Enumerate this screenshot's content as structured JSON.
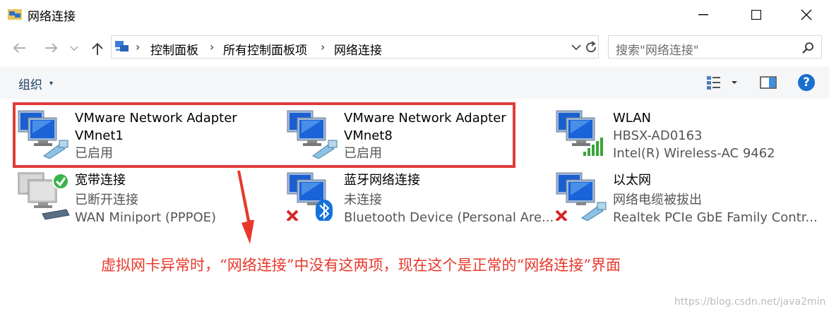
{
  "window": {
    "title": "网络连接"
  },
  "address": {
    "crumbs": [
      "控制面板",
      "所有控制面板项",
      "网络连接"
    ],
    "separator": "›"
  },
  "search": {
    "placeholder": "搜索\"网络连接\""
  },
  "toolbar": {
    "organize_label": "组织",
    "organize_caret": "▾",
    "help_glyph": "?"
  },
  "items": [
    {
      "name_line1": "VMware Network Adapter",
      "name_line2": "VMnet1",
      "status": "已启用"
    },
    {
      "name_line1": "VMware Network Adapter",
      "name_line2": "VMnet8",
      "status": "已启用"
    },
    {
      "name": "WLAN",
      "status": "HBSX-AD0163",
      "device": "Intel(R) Wireless-AC 9462"
    },
    {
      "name": "宽带连接",
      "status": "已断开连接",
      "device": "WAN Miniport (PPPOE)"
    },
    {
      "name": "蓝牙网络连接",
      "status": "未连接",
      "device": "Bluetooth Device (Personal Are..."
    },
    {
      "name": "以太网",
      "status": "网络电缆被拔出",
      "device": "Realtek PCIe GbE Family Contr..."
    }
  ],
  "annotation": "虚拟网卡异常时，“网络连接”中没有这两项，现在这个是正常的“网络连接”界面",
  "watermark": "https://blog.csdn.net/java2min",
  "colors": {
    "highlight_red": "#e03b3b",
    "annotation_red": "#e8382b",
    "link_blue": "#1e3f66"
  }
}
